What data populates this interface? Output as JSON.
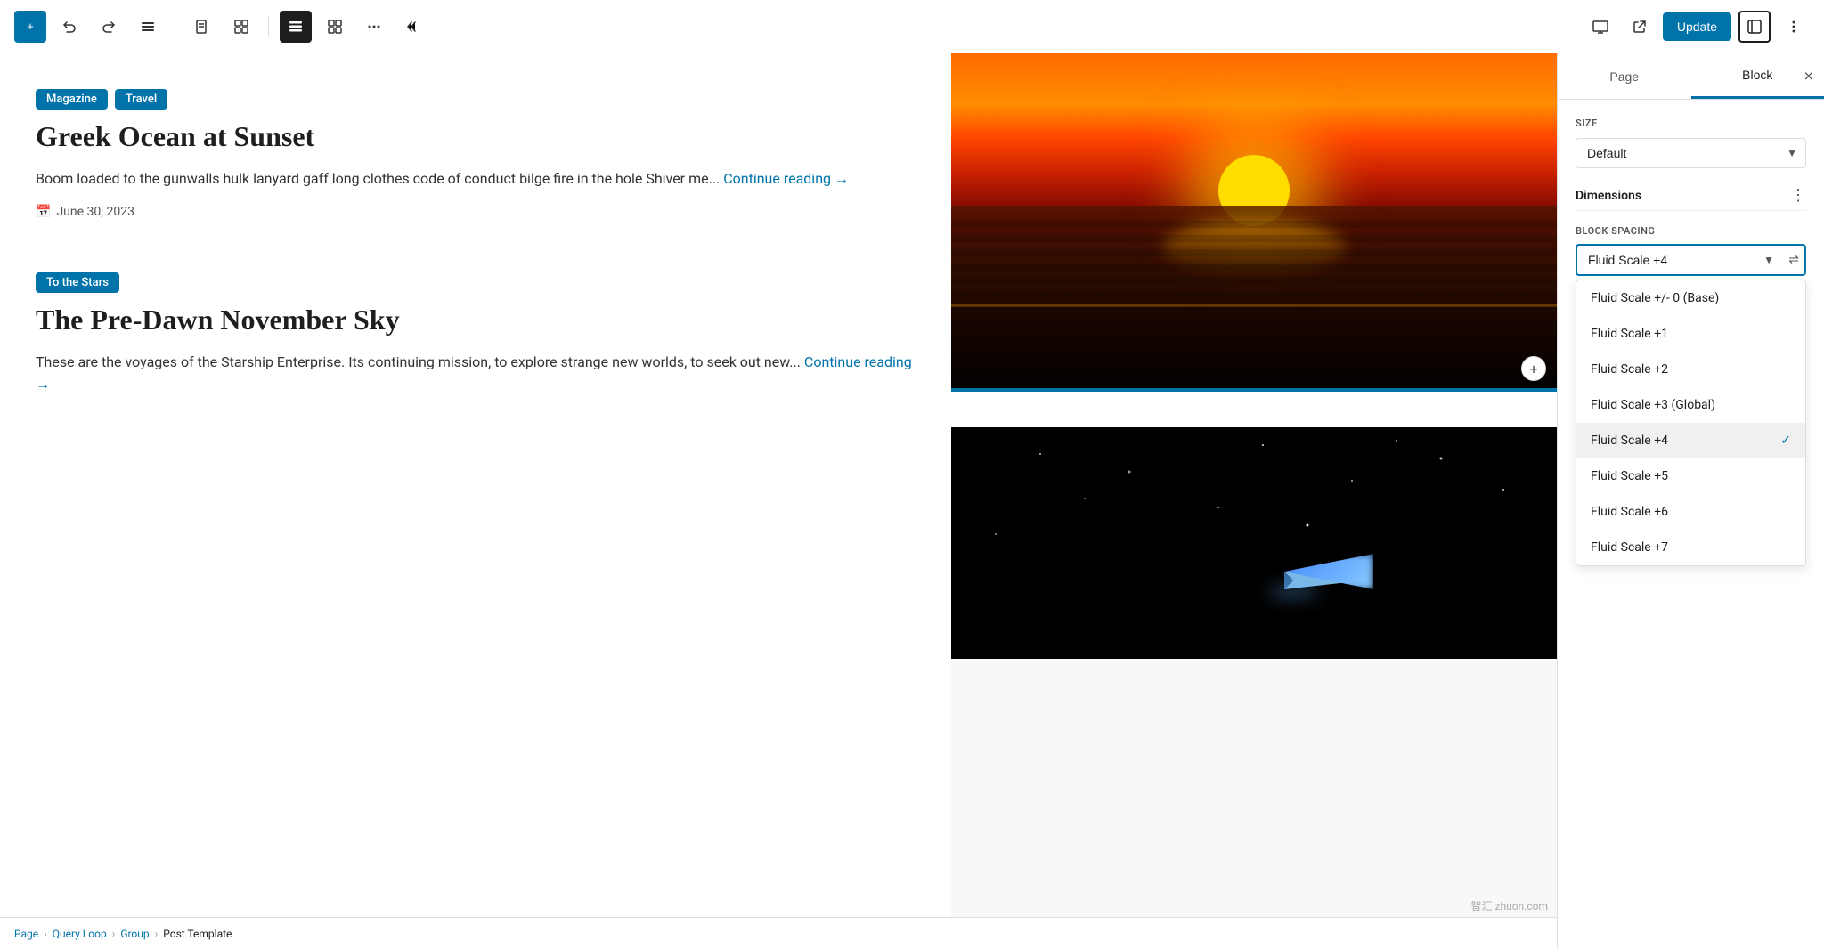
{
  "toolbar": {
    "add_label": "+",
    "undo_label": "↩",
    "redo_label": "↪",
    "list_view_label": "≡",
    "document_icon": "☰",
    "grid_icon": "⊞",
    "more_label": "•••",
    "collapse_label": "««",
    "update_label": "Update",
    "view_icon": "□",
    "external_icon": "↗",
    "settings_icon": "▣",
    "ellipsis_icon": "⋮"
  },
  "right_panel": {
    "tab_page": "Page",
    "tab_block": "Block",
    "close_icon": "×",
    "size_label": "SIZE",
    "size_default": "Default",
    "dimensions_label": "Dimensions",
    "block_spacing_label": "BLOCK SPACING",
    "block_spacing_value": "Fluid Scale +4",
    "dropdown_options": [
      {
        "label": "Fluid Scale +/- 0 (Base)",
        "selected": false
      },
      {
        "label": "Fluid Scale +1",
        "selected": false
      },
      {
        "label": "Fluid Scale +2",
        "selected": false
      },
      {
        "label": "Fluid Scale +3 (Global)",
        "selected": false
      },
      {
        "label": "Fluid Scale +4",
        "selected": true
      },
      {
        "label": "Fluid Scale +5",
        "selected": false
      },
      {
        "label": "Fluid Scale +6",
        "selected": false
      },
      {
        "label": "Fluid Scale +7",
        "selected": false
      }
    ]
  },
  "posts": [
    {
      "tags": [
        "Magazine",
        "Travel"
      ],
      "title": "Greek Ocean at Sunset",
      "excerpt": "Boom loaded to the gunwalls hulk lanyard gaff long clothes code of conduct bilge fire in the hole Shiver me...",
      "continue_reading": "Continue reading →",
      "date": "June 30, 2023"
    },
    {
      "tags": [
        "To the Stars"
      ],
      "title": "The Pre-Dawn November Sky",
      "excerpt": "These are the voyages of the Starship Enterprise. Its continuing mission, to explore strange new worlds, to seek out new...",
      "continue_reading": "Continue reading →",
      "date": ""
    }
  ],
  "breadcrumb": {
    "items": [
      "Page",
      "Query Loop",
      "Group",
      "Post Template"
    ]
  },
  "watermark": "智汇 zhuon.com"
}
